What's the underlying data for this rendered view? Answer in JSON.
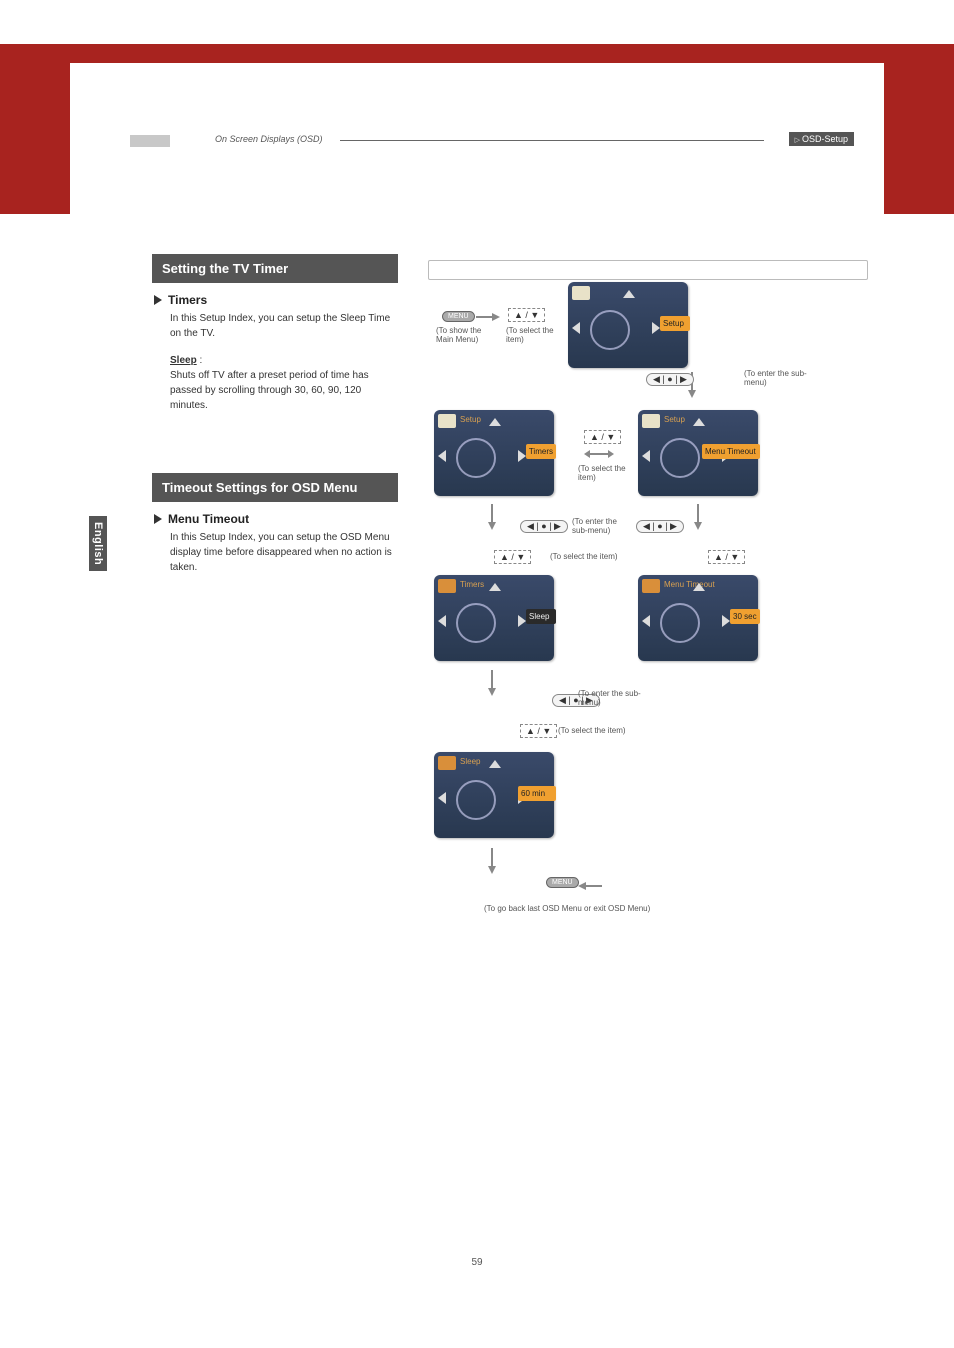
{
  "header": {
    "breadcrumb": "On Screen Displays (OSD)",
    "badge": "OSD-Setup"
  },
  "side_tab": "English",
  "page_number": "59",
  "sections": {
    "timer": {
      "title": "Setting the TV Timer",
      "heading": "Timers",
      "desc": "In this Setup Index, you can setup the Sleep Time on the TV.",
      "sub_label": "Sleep",
      "sub_colon": " :",
      "sub_desc": "Shuts off TV after a preset period of time has passed by scrolling through 30, 60, 90, 120 minutes."
    },
    "timeout": {
      "title": "Timeout Settings for OSD Menu",
      "heading": "Menu Timeout",
      "desc": "In this Setup Index, you can setup the OSD Menu display time before disappeared when no action is taken."
    }
  },
  "diagram": {
    "menu_btn": "MENU",
    "show_main": "(To show the Main Menu)",
    "select_item": "(To select the item)",
    "enter_sub": "(To enter the sub-menu)",
    "select_the_item": "(To select the item)",
    "go_back": "(To go back last OSD Menu or exit OSD Menu)",
    "tiles": {
      "setup": "Setup",
      "setup2": "Setup",
      "setup3": "Setup",
      "timers": "Timers",
      "timers2": "Timers",
      "menu_timeout": "Menu Timeout",
      "menu_timeout2": "Menu Timeout",
      "sleep": "Sleep",
      "sleep2": "Sleep",
      "thirty_sec": "30 sec",
      "sixty_min": "60 min"
    }
  }
}
